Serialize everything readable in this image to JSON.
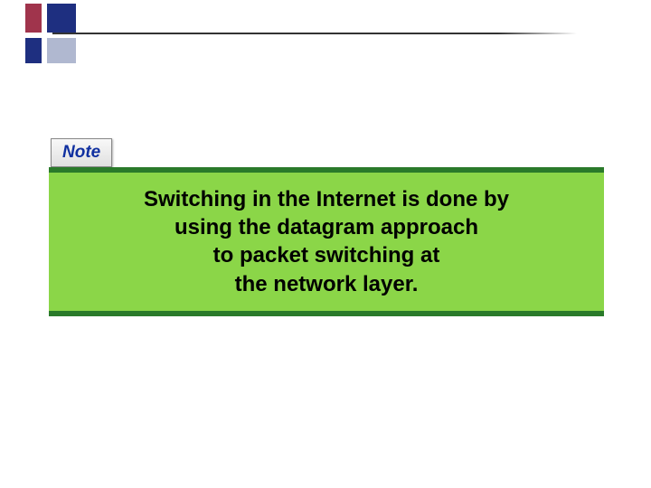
{
  "note": {
    "label": "Note"
  },
  "callout": {
    "line1": "Switching in the Internet is done by",
    "line2": "using the datagram approach",
    "line3": "to packet switching at",
    "line4": "the network layer."
  }
}
